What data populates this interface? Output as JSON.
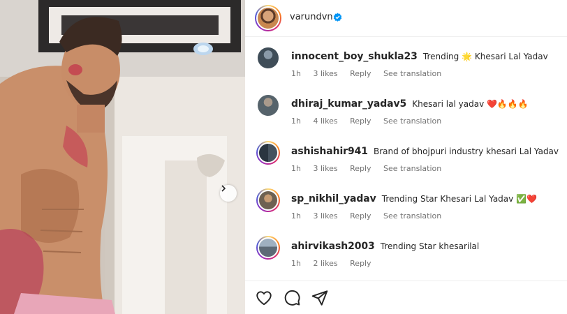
{
  "post": {
    "author": "varundvn",
    "verified": true,
    "media_next_icon": "chevron-right-icon"
  },
  "comments": [
    {
      "username": "innocent_boy_shukla23",
      "text": "Trending 🌟 Khesari Lal Yadav",
      "time": "1h",
      "likes": "3 likes",
      "reply": "Reply",
      "see_translation": "See translation",
      "avatar_color": "#4a5a6a",
      "ring": false
    },
    {
      "username": "dhiraj_kumar_yadav5",
      "text": "Khesari lal yadav ❤️🔥🔥🔥",
      "time": "1h",
      "likes": "4 likes",
      "reply": "Reply",
      "see_translation": "See translation",
      "avatar_color": "#5b6b74",
      "ring": false
    },
    {
      "username": "ashishahir941",
      "text": "Brand of bhojpuri industry khesari Lal Yadav",
      "time": "1h",
      "likes": "3 likes",
      "reply": "Reply",
      "see_translation": "See translation",
      "avatar_color": "#2f3b46",
      "ring": true
    },
    {
      "username": "sp_nikhil_yadav",
      "text": "Trending Star Khesari Lal Yadav ✅❤️",
      "time": "1h",
      "likes": "3 likes",
      "reply": "Reply",
      "see_translation": "See translation",
      "avatar_color": "#7a6b58",
      "ring": true
    },
    {
      "username": "ahirvikash2003",
      "text": "Trending Star khesarilal",
      "time": "1h",
      "likes": "2 likes",
      "reply": "Reply",
      "see_translation": "",
      "avatar_color": "#6f7f8f",
      "ring": true
    }
  ],
  "actions": {
    "like_icon": "heart-icon",
    "comment_icon": "comment-icon",
    "share_icon": "share-icon"
  },
  "colors": {
    "verified_badge": "#0095f6",
    "meta_text": "#737373"
  }
}
